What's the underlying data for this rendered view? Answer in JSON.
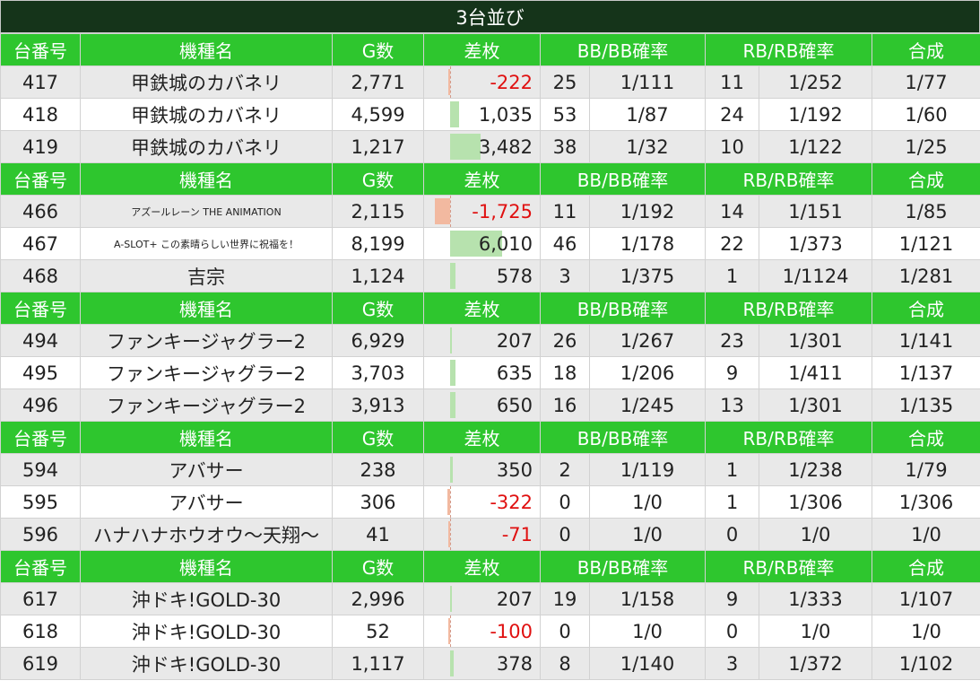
{
  "title": "3台並び",
  "headers": [
    "台番号",
    "機種名",
    "G数",
    "差枚",
    "BB/BB確率",
    "RB/RB確率",
    "合成"
  ],
  "groups": [
    {
      "rows": [
        {
          "no": "417",
          "name": "甲鉄城のカバネリ",
          "g": "2,771",
          "diff": "-222",
          "diff_value": -222,
          "bb": "25",
          "bbp": "1/111",
          "rb": "11",
          "rbp": "1/252",
          "total": "1/77"
        },
        {
          "no": "418",
          "name": "甲鉄城のカバネリ",
          "g": "4,599",
          "diff": "1,035",
          "diff_value": 1035,
          "bb": "53",
          "bbp": "1/87",
          "rb": "24",
          "rbp": "1/192",
          "total": "1/60"
        },
        {
          "no": "419",
          "name": "甲鉄城のカバネリ",
          "g": "1,217",
          "diff": "3,482",
          "diff_value": 3482,
          "bb": "38",
          "bbp": "1/32",
          "rb": "10",
          "rbp": "1/122",
          "total": "1/25"
        }
      ]
    },
    {
      "rows": [
        {
          "no": "466",
          "name": "アズールレーン THE ANIMATION",
          "g": "2,115",
          "diff": "-1,725",
          "diff_value": -1725,
          "bb": "11",
          "bbp": "1/192",
          "rb": "14",
          "rbp": "1/151",
          "total": "1/85"
        },
        {
          "no": "467",
          "name": "A-SLOT+ この素晴らしい世界に祝福を！",
          "g": "8,199",
          "diff": "6,010",
          "diff_value": 6010,
          "bb": "46",
          "bbp": "1/178",
          "rb": "22",
          "rbp": "1/373",
          "total": "1/121"
        },
        {
          "no": "468",
          "name": "吉宗",
          "g": "1,124",
          "diff": "578",
          "diff_value": 578,
          "bb": "3",
          "bbp": "1/375",
          "rb": "1",
          "rbp": "1/1124",
          "total": "1/281"
        }
      ]
    },
    {
      "rows": [
        {
          "no": "494",
          "name": "ファンキージャグラー2",
          "g": "6,929",
          "diff": "207",
          "diff_value": 207,
          "bb": "26",
          "bbp": "1/267",
          "rb": "23",
          "rbp": "1/301",
          "total": "1/141"
        },
        {
          "no": "495",
          "name": "ファンキージャグラー2",
          "g": "3,703",
          "diff": "635",
          "diff_value": 635,
          "bb": "18",
          "bbp": "1/206",
          "rb": "9",
          "rbp": "1/411",
          "total": "1/137"
        },
        {
          "no": "496",
          "name": "ファンキージャグラー2",
          "g": "3,913",
          "diff": "650",
          "diff_value": 650,
          "bb": "16",
          "bbp": "1/245",
          "rb": "13",
          "rbp": "1/301",
          "total": "1/135"
        }
      ]
    },
    {
      "rows": [
        {
          "no": "594",
          "name": "アバサー",
          "g": "238",
          "diff": "350",
          "diff_value": 350,
          "bb": "2",
          "bbp": "1/119",
          "rb": "1",
          "rbp": "1/238",
          "total": "1/79"
        },
        {
          "no": "595",
          "name": "アバサー",
          "g": "306",
          "diff": "-322",
          "diff_value": -322,
          "bb": "0",
          "bbp": "1/0",
          "rb": "1",
          "rbp": "1/306",
          "total": "1/306"
        },
        {
          "no": "596",
          "name": "ハナハナホウオウ～天翔～",
          "g": "41",
          "diff": "-71",
          "diff_value": -71,
          "bb": "0",
          "bbp": "1/0",
          "rb": "0",
          "rbp": "1/0",
          "total": "1/0"
        }
      ]
    },
    {
      "rows": [
        {
          "no": "617",
          "name": "沖ドキ!GOLD-30",
          "g": "2,996",
          "diff": "207",
          "diff_value": 207,
          "bb": "19",
          "bbp": "1/158",
          "rb": "9",
          "rbp": "1/333",
          "total": "1/107"
        },
        {
          "no": "618",
          "name": "沖ドキ!GOLD-30",
          "g": "52",
          "diff": "-100",
          "diff_value": -100,
          "bb": "0",
          "bbp": "1/0",
          "rb": "0",
          "rbp": "1/0",
          "total": "1/0"
        },
        {
          "no": "619",
          "name": "沖ドキ!GOLD-30",
          "g": "1,117",
          "diff": "378",
          "diff_value": 378,
          "bb": "8",
          "bbp": "1/140",
          "rb": "3",
          "rbp": "1/372",
          "total": "1/102"
        }
      ]
    }
  ]
}
